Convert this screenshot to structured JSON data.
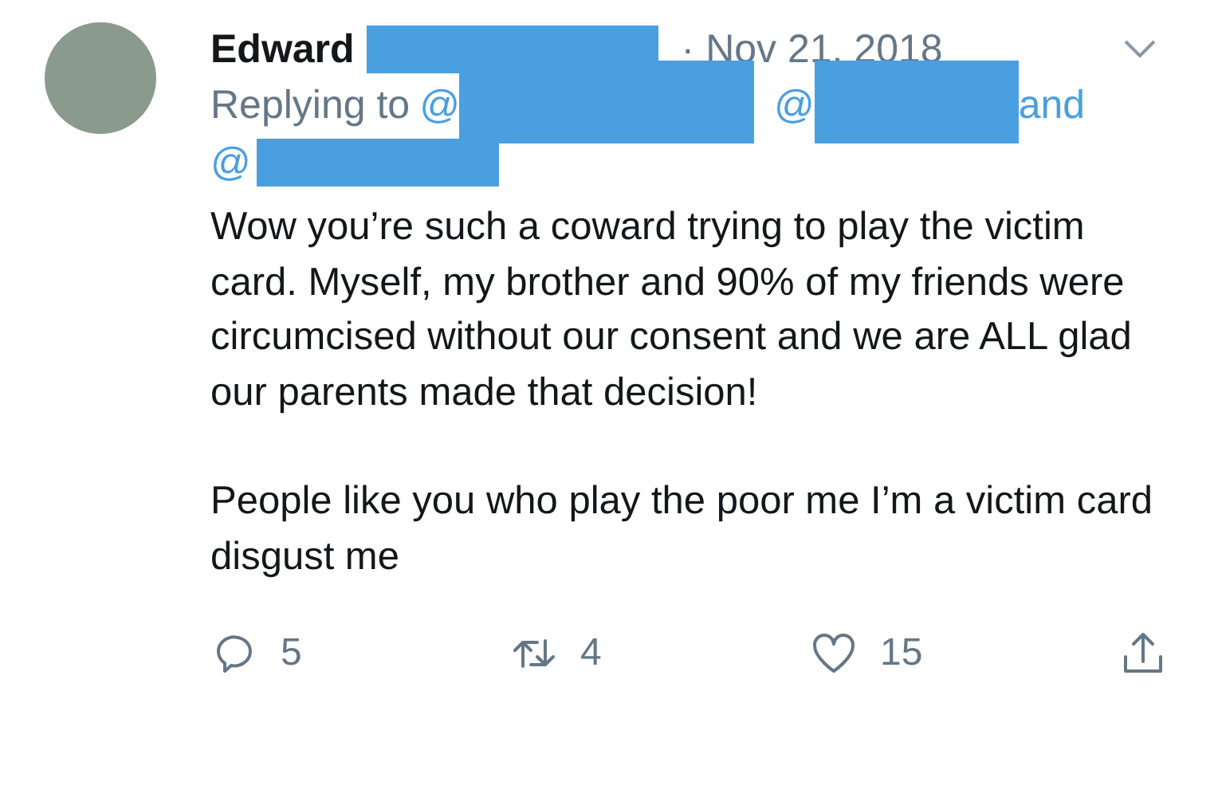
{
  "tweet": {
    "author": "Edward",
    "date": "· Nov 21, 2018",
    "reply_line": {
      "label": "Replying to",
      "mentions": [
        "@",
        "@",
        "@"
      ],
      "conjunction": "and"
    },
    "paragraphs": [
      "Wow you’re such a coward trying to play the victim card. Myself, my brother and 90% of my friends were circumcised without our consent and we are ALL glad our parents made that decision!",
      "People like you who play the poor me I’m a victim card disgust me"
    ],
    "actions": [
      {
        "kind": "reply",
        "count": "5"
      },
      {
        "kind": "retweet",
        "count": "4"
      },
      {
        "kind": "like",
        "count": "15"
      },
      {
        "kind": "share"
      }
    ]
  }
}
